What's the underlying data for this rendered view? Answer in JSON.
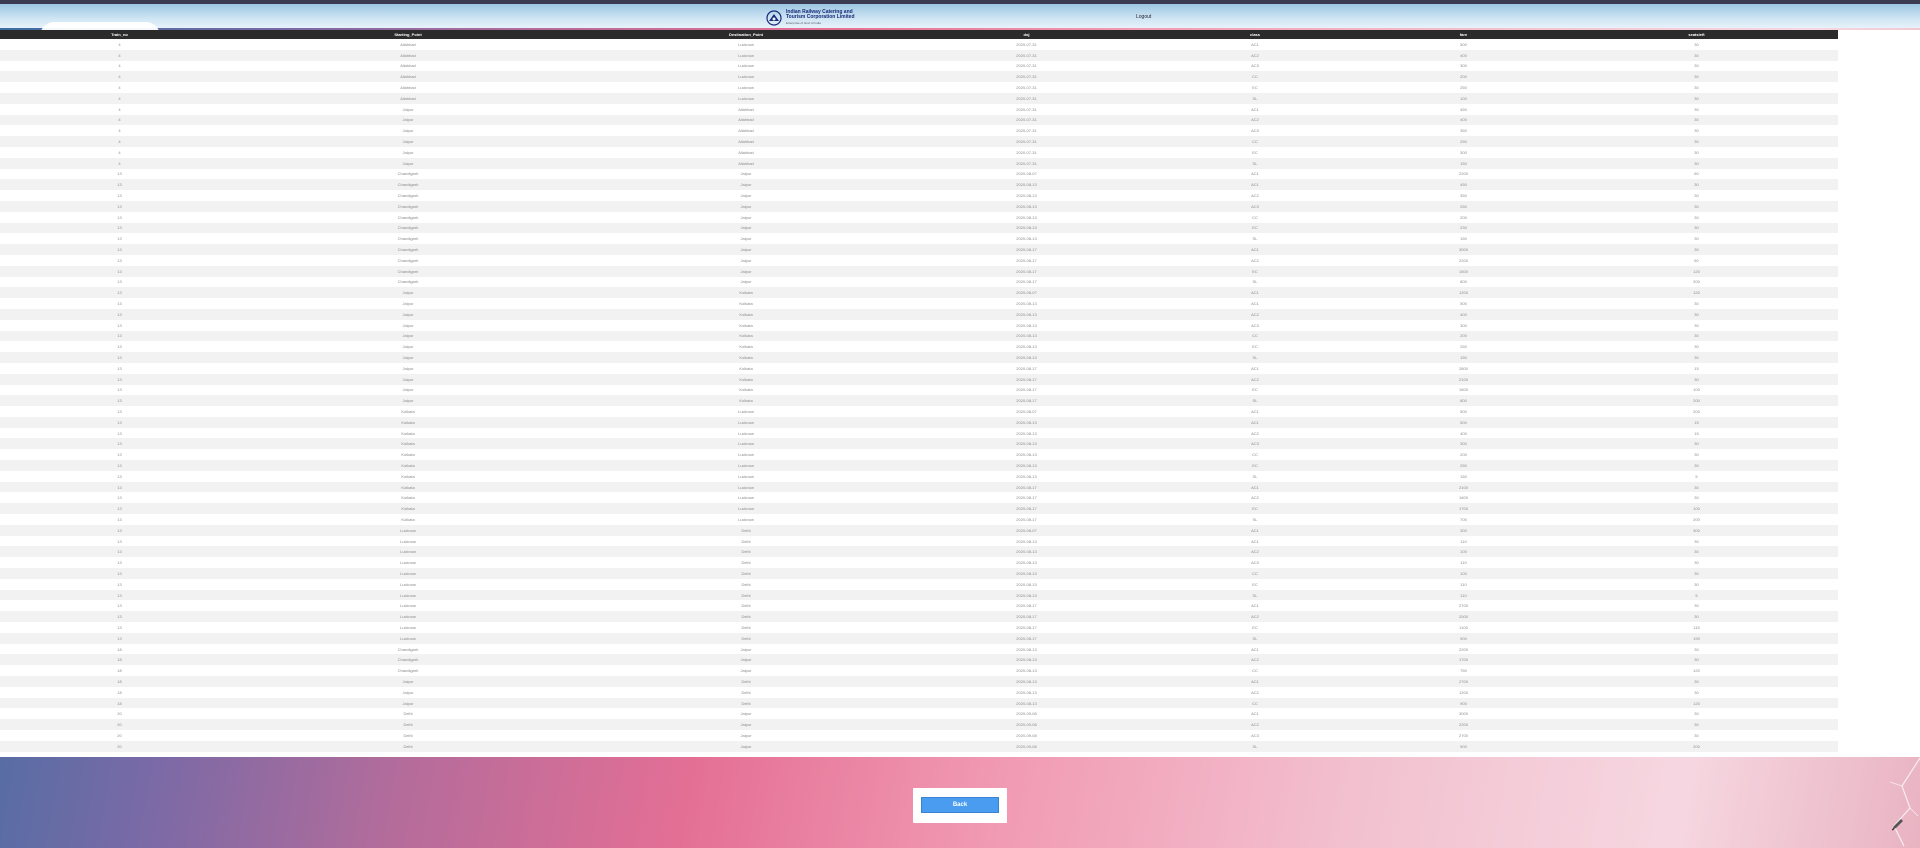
{
  "header": {
    "logo_line1": "Indian Railway Catering and",
    "logo_line2": "Tourism Corporation Limited",
    "logo_line3": "Enterprise of Govt of India",
    "logout_label": "Logout"
  },
  "table": {
    "columns": [
      "Train_no",
      "Starting_Point",
      "Destination_Point",
      "doj",
      "class",
      "fare",
      "seatsleft"
    ],
    "rows": [
      [
        "4",
        "Allahbad",
        "Lucknow",
        "2020-07-31",
        "AC1",
        "500",
        "30"
      ],
      [
        "4",
        "Allahbad",
        "Lucknow",
        "2020-07-31",
        "AC2",
        "400",
        "30"
      ],
      [
        "4",
        "Allahbad",
        "Lucknow",
        "2020-07-31",
        "AC3",
        "300",
        "30"
      ],
      [
        "4",
        "Allahbad",
        "Lucknow",
        "2020-07-31",
        "CC",
        "200",
        "30"
      ],
      [
        "4",
        "Allahbad",
        "Lucknow",
        "2020-07-31",
        "EC",
        "250",
        "30"
      ],
      [
        "4",
        "Allahbad",
        "Lucknow",
        "2020-07-31",
        "SL",
        "100",
        "30"
      ],
      [
        "4",
        "Jaipur",
        "Allahbad",
        "2020-07-31",
        "AC1",
        "450",
        "30"
      ],
      [
        "4",
        "Jaipur",
        "Allahbad",
        "2020-07-31",
        "AC2",
        "400",
        "30"
      ],
      [
        "4",
        "Jaipur",
        "Allahbad",
        "2020-07-31",
        "AC3",
        "350",
        "30"
      ],
      [
        "4",
        "Jaipur",
        "Allahbad",
        "2020-07-31",
        "CC",
        "250",
        "30"
      ],
      [
        "4",
        "Jaipur",
        "Allahbad",
        "2020-07-31",
        "EC",
        "300",
        "30"
      ],
      [
        "4",
        "Jaipur",
        "Allahbad",
        "2020-07-31",
        "SL",
        "150",
        "30"
      ],
      [
        "13",
        "Chandigarh",
        "Jaipur",
        "2020-08-07",
        "AC1",
        "2200",
        "60"
      ],
      [
        "13",
        "Chandigarh",
        "Jaipur",
        "2020-08-13",
        "AC1",
        "450",
        "30"
      ],
      [
        "13",
        "Chandigarh",
        "Jaipur",
        "2020-08-13",
        "AC2",
        "350",
        "30"
      ],
      [
        "13",
        "Chandigarh",
        "Jaipur",
        "2020-08-13",
        "AC3",
        "250",
        "30"
      ],
      [
        "13",
        "Chandigarh",
        "Jaipur",
        "2020-08-13",
        "CC",
        "200",
        "30"
      ],
      [
        "13",
        "Chandigarh",
        "Jaipur",
        "2020-08-13",
        "EC",
        "230",
        "30"
      ],
      [
        "13",
        "Chandigarh",
        "Jaipur",
        "2020-08-13",
        "SL",
        "150",
        "30"
      ],
      [
        "13",
        "Chandigarh",
        "Jaipur",
        "2020-08-17",
        "AC1",
        "3000",
        "30"
      ],
      [
        "13",
        "Chandigarh",
        "Jaipur",
        "2020-08-17",
        "AC2",
        "2200",
        "60"
      ],
      [
        "13",
        "Chandigarh",
        "Jaipur",
        "2020-08-17",
        "EC",
        "1500",
        "120"
      ],
      [
        "13",
        "Chandigarh",
        "Jaipur",
        "2020-08-17",
        "SL",
        "800",
        "200"
      ],
      [
        "13",
        "Jaipur",
        "Kolkata",
        "2020-08-07",
        "AC1",
        "1200",
        "120"
      ],
      [
        "13",
        "Jaipur",
        "Kolkata",
        "2020-08-13",
        "AC1",
        "500",
        "30"
      ],
      [
        "13",
        "Jaipur",
        "Kolkata",
        "2020-08-13",
        "AC2",
        "400",
        "30"
      ],
      [
        "13",
        "Jaipur",
        "Kolkata",
        "2020-08-13",
        "AC3",
        "300",
        "30"
      ],
      [
        "13",
        "Jaipur",
        "Kolkata",
        "2020-08-13",
        "CC",
        "200",
        "30"
      ],
      [
        "13",
        "Jaipur",
        "Kolkata",
        "2020-08-13",
        "EC",
        "250",
        "30"
      ],
      [
        "13",
        "Jaipur",
        "Kolkata",
        "2020-08-13",
        "SL",
        "150",
        "30"
      ],
      [
        "13",
        "Jaipur",
        "Kolkata",
        "2020-08-17",
        "AC1",
        "2800",
        "15"
      ],
      [
        "13",
        "Jaipur",
        "Kolkata",
        "2020-08-17",
        "AC2",
        "2100",
        "30"
      ],
      [
        "13",
        "Jaipur",
        "Kolkata",
        "2020-08-17",
        "EC",
        "1600",
        "100"
      ],
      [
        "13",
        "Jaipur",
        "Kolkata",
        "2020-08-17",
        "SL",
        "800",
        "200"
      ],
      [
        "13",
        "Kolkata",
        "Lucknow",
        "2020-08-07",
        "AC1",
        "500",
        "200"
      ],
      [
        "13",
        "Kolkata",
        "Lucknow",
        "2020-08-13",
        "AC1",
        "500",
        "15"
      ],
      [
        "13",
        "Kolkata",
        "Lucknow",
        "2020-08-13",
        "AC2",
        "400",
        "15"
      ],
      [
        "13",
        "Kolkata",
        "Lucknow",
        "2020-08-13",
        "AC3",
        "300",
        "30"
      ],
      [
        "13",
        "Kolkata",
        "Lucknow",
        "2020-08-13",
        "CC",
        "200",
        "30"
      ],
      [
        "13",
        "Kolkata",
        "Lucknow",
        "2020-08-13",
        "EC",
        "250",
        "30"
      ],
      [
        "13",
        "Kolkata",
        "Lucknow",
        "2020-08-13",
        "SL",
        "150",
        "5"
      ],
      [
        "13",
        "Kolkata",
        "Lucknow",
        "2020-08-17",
        "AC1",
        "2100",
        "30"
      ],
      [
        "13",
        "Kolkata",
        "Lucknow",
        "2020-08-17",
        "AC2",
        "1600",
        "30"
      ],
      [
        "13",
        "Kolkata",
        "Lucknow",
        "2020-08-17",
        "EC",
        "1700",
        "100"
      ],
      [
        "13",
        "Kolkata",
        "Lucknow",
        "2020-08-17",
        "SL",
        "700",
        "200"
      ],
      [
        "13",
        "Lucknow",
        "Delhi",
        "2020-08-07",
        "AC1",
        "300",
        "300"
      ],
      [
        "13",
        "Lucknow",
        "Delhi",
        "2020-08-13",
        "AC1",
        "110",
        "30"
      ],
      [
        "13",
        "Lucknow",
        "Delhi",
        "2020-08-13",
        "AC2",
        "100",
        "30"
      ],
      [
        "13",
        "Lucknow",
        "Delhi",
        "2020-08-13",
        "AC3",
        "110",
        "30"
      ],
      [
        "13",
        "Lucknow",
        "Delhi",
        "2020-08-13",
        "CC",
        "100",
        "30"
      ],
      [
        "13",
        "Lucknow",
        "Delhi",
        "2020-08-13",
        "EC",
        "110",
        "30"
      ],
      [
        "13",
        "Lucknow",
        "Delhi",
        "2020-08-13",
        "SL",
        "110",
        "5"
      ],
      [
        "13",
        "Lucknow",
        "Delhi",
        "2020-08-17",
        "AC1",
        "2700",
        "30"
      ],
      [
        "13",
        "Lucknow",
        "Delhi",
        "2020-08-17",
        "AC2",
        "2000",
        "30"
      ],
      [
        "13",
        "Lucknow",
        "Delhi",
        "2020-08-17",
        "EC",
        "1100",
        "115"
      ],
      [
        "13",
        "Lucknow",
        "Delhi",
        "2020-08-17",
        "SL",
        "900",
        "190"
      ],
      [
        "18",
        "Chandigarh",
        "Jaipur",
        "2020-08-13",
        "AC1",
        "2200",
        "30"
      ],
      [
        "18",
        "Chandigarh",
        "Jaipur",
        "2020-08-13",
        "AC2",
        "1700",
        "30"
      ],
      [
        "18",
        "Chandigarh",
        "Jaipur",
        "2020-08-13",
        "CC",
        "750",
        "120"
      ],
      [
        "18",
        "Jaipur",
        "Delhi",
        "2020-08-13",
        "AC1",
        "2700",
        "30"
      ],
      [
        "18",
        "Jaipur",
        "Delhi",
        "2020-08-13",
        "AC2",
        "1200",
        "30"
      ],
      [
        "18",
        "Jaipur",
        "Delhi",
        "2020-08-13",
        "CC",
        "900",
        "120"
      ],
      [
        "20",
        "Delhi",
        "Jaipur",
        "2020-09-08",
        "AC1",
        "3000",
        "30"
      ],
      [
        "20",
        "Delhi",
        "Jaipur",
        "2020-09-08",
        "AC2",
        "2200",
        "30"
      ],
      [
        "20",
        "Delhi",
        "Jaipur",
        "2020-09-08",
        "AC3",
        "2700",
        "30"
      ],
      [
        "20",
        "Delhi",
        "Jaipur",
        "2020-09-08",
        "SL",
        "900",
        "200"
      ]
    ]
  },
  "footer": {
    "back_label": "Back"
  }
}
